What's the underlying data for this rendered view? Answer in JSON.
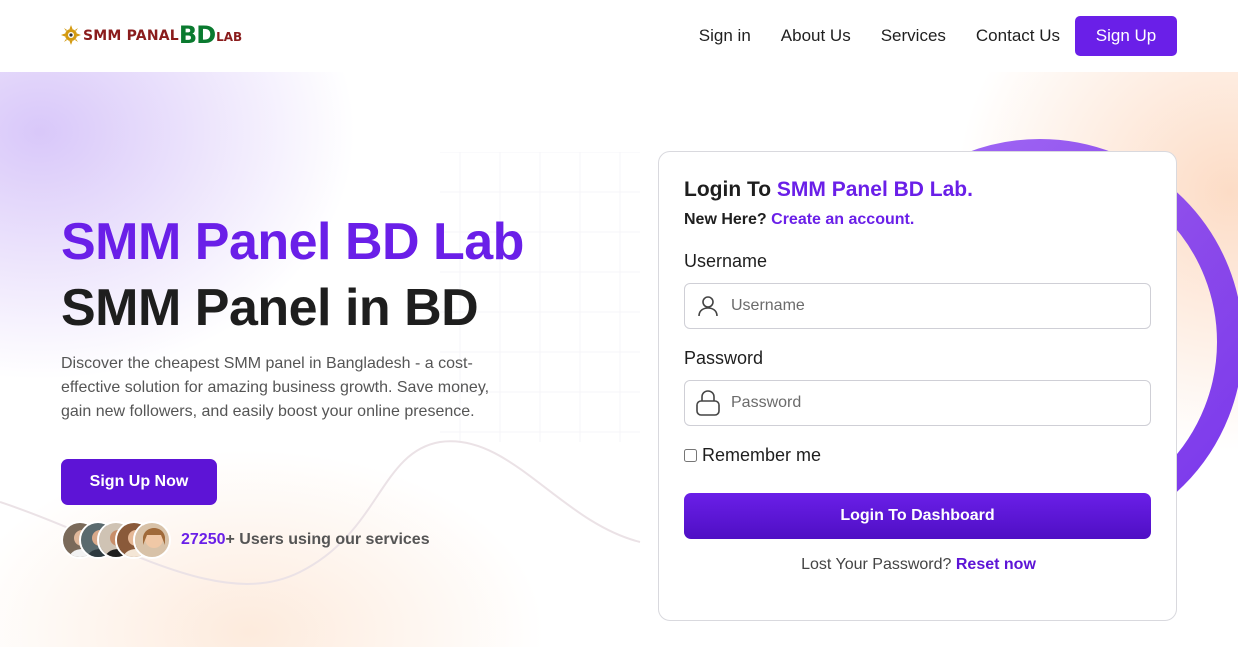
{
  "brand": {
    "logo_smm": "SMM PANAL",
    "logo_bd": "BD",
    "logo_lab": "LAB"
  },
  "nav": {
    "items": [
      "Sign in",
      "About Us",
      "Services",
      "Contact Us"
    ],
    "signup": "Sign Up"
  },
  "hero": {
    "title_line1": "SMM Panel BD Lab",
    "title_line2": "SMM Panel in BD",
    "description": "Discover the cheapest SMM panel in Bangladesh - a cost-effective solution for amazing business growth. Save money, gain new followers, and easily boost your online presence.",
    "cta": "Sign Up Now",
    "users_count": "27250",
    "users_suffix": "+ Users using our services"
  },
  "login": {
    "title_prefix": "Login To ",
    "title_brand": "SMM Panel BD Lab.",
    "new_here": "New Here? ",
    "create_account": "Create an account.",
    "username_label": "Username",
    "username_placeholder": "Username",
    "password_label": "Password",
    "password_placeholder": "Password",
    "remember_label": "Remember me",
    "submit": "Login To Dashboard",
    "lost_password": "Lost Your Password? ",
    "reset_link": "Reset now"
  },
  "icons": {
    "logo": "sun-logo-icon",
    "username": "user-icon",
    "password": "lock-icon"
  },
  "colors": {
    "accent": "#6a1fe8",
    "button": "#5d14d6",
    "text": "#1e1e1e"
  }
}
